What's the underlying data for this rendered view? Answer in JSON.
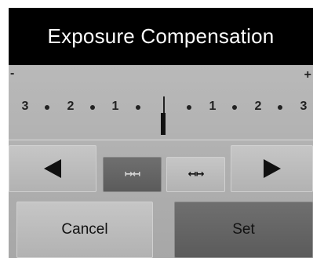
{
  "dialog": {
    "title": "Exposure Compensation"
  },
  "scale": {
    "minus_label": "-",
    "plus_label": "+",
    "left_labels": [
      "3",
      "2",
      "1"
    ],
    "right_labels": [
      "1",
      "2",
      "3"
    ],
    "current_value": 0
  },
  "nav": {
    "left_icon": "arrow-left-icon",
    "collapse_icon": "collapse-step-icon",
    "expand_icon": "expand-step-icon",
    "right_icon": "arrow-right-icon",
    "collapse_glyph": "↦↤",
    "expand_glyph": "↤↦"
  },
  "actions": {
    "cancel_label": "Cancel",
    "set_label": "Set"
  },
  "colors": {
    "title_bg": "#000000",
    "title_text": "#ffffff",
    "panel_bg": "#b0b0b0",
    "selected_button": "#666666"
  }
}
